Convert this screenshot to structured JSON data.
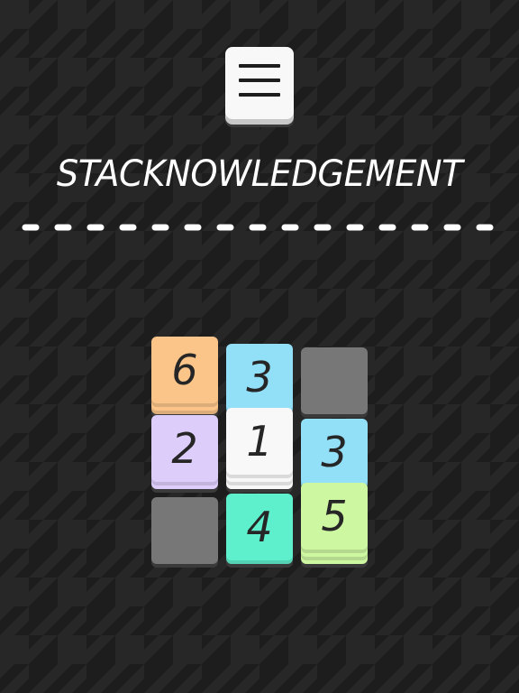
{
  "game": {
    "title": "STACKNOWLEDGEMENT"
  },
  "menu_button": {
    "icon": "hamburger-menu-icon"
  },
  "colors": {
    "background": "#1d1d1d",
    "pattern": "#262626",
    "orange": "#fbc58a",
    "blue": "#92dff8",
    "purple": "#ddcdfa",
    "white": "#f8f8f8",
    "teal": "#5ef0cc",
    "green": "#cdf7a1",
    "gray": "#777777"
  },
  "board": {
    "rows": 3,
    "cols": 3,
    "cells": [
      {
        "row": 0,
        "col": 0,
        "value": "6",
        "color": "orange",
        "stack": 3
      },
      {
        "row": 0,
        "col": 1,
        "value": "3",
        "color": "blue",
        "stack": 1
      },
      {
        "row": 0,
        "col": 2,
        "value": "",
        "color": "gray",
        "stack": 0
      },
      {
        "row": 1,
        "col": 0,
        "value": "2",
        "color": "purple",
        "stack": 2
      },
      {
        "row": 1,
        "col": 1,
        "value": "1",
        "color": "white",
        "stack": 4
      },
      {
        "row": 1,
        "col": 2,
        "value": "3",
        "color": "blue",
        "stack": 1
      },
      {
        "row": 2,
        "col": 0,
        "value": "",
        "color": "gray",
        "stack": 0
      },
      {
        "row": 2,
        "col": 1,
        "value": "4",
        "color": "teal",
        "stack": 1
      },
      {
        "row": 2,
        "col": 2,
        "value": "5",
        "color": "green",
        "stack": 4
      }
    ]
  }
}
